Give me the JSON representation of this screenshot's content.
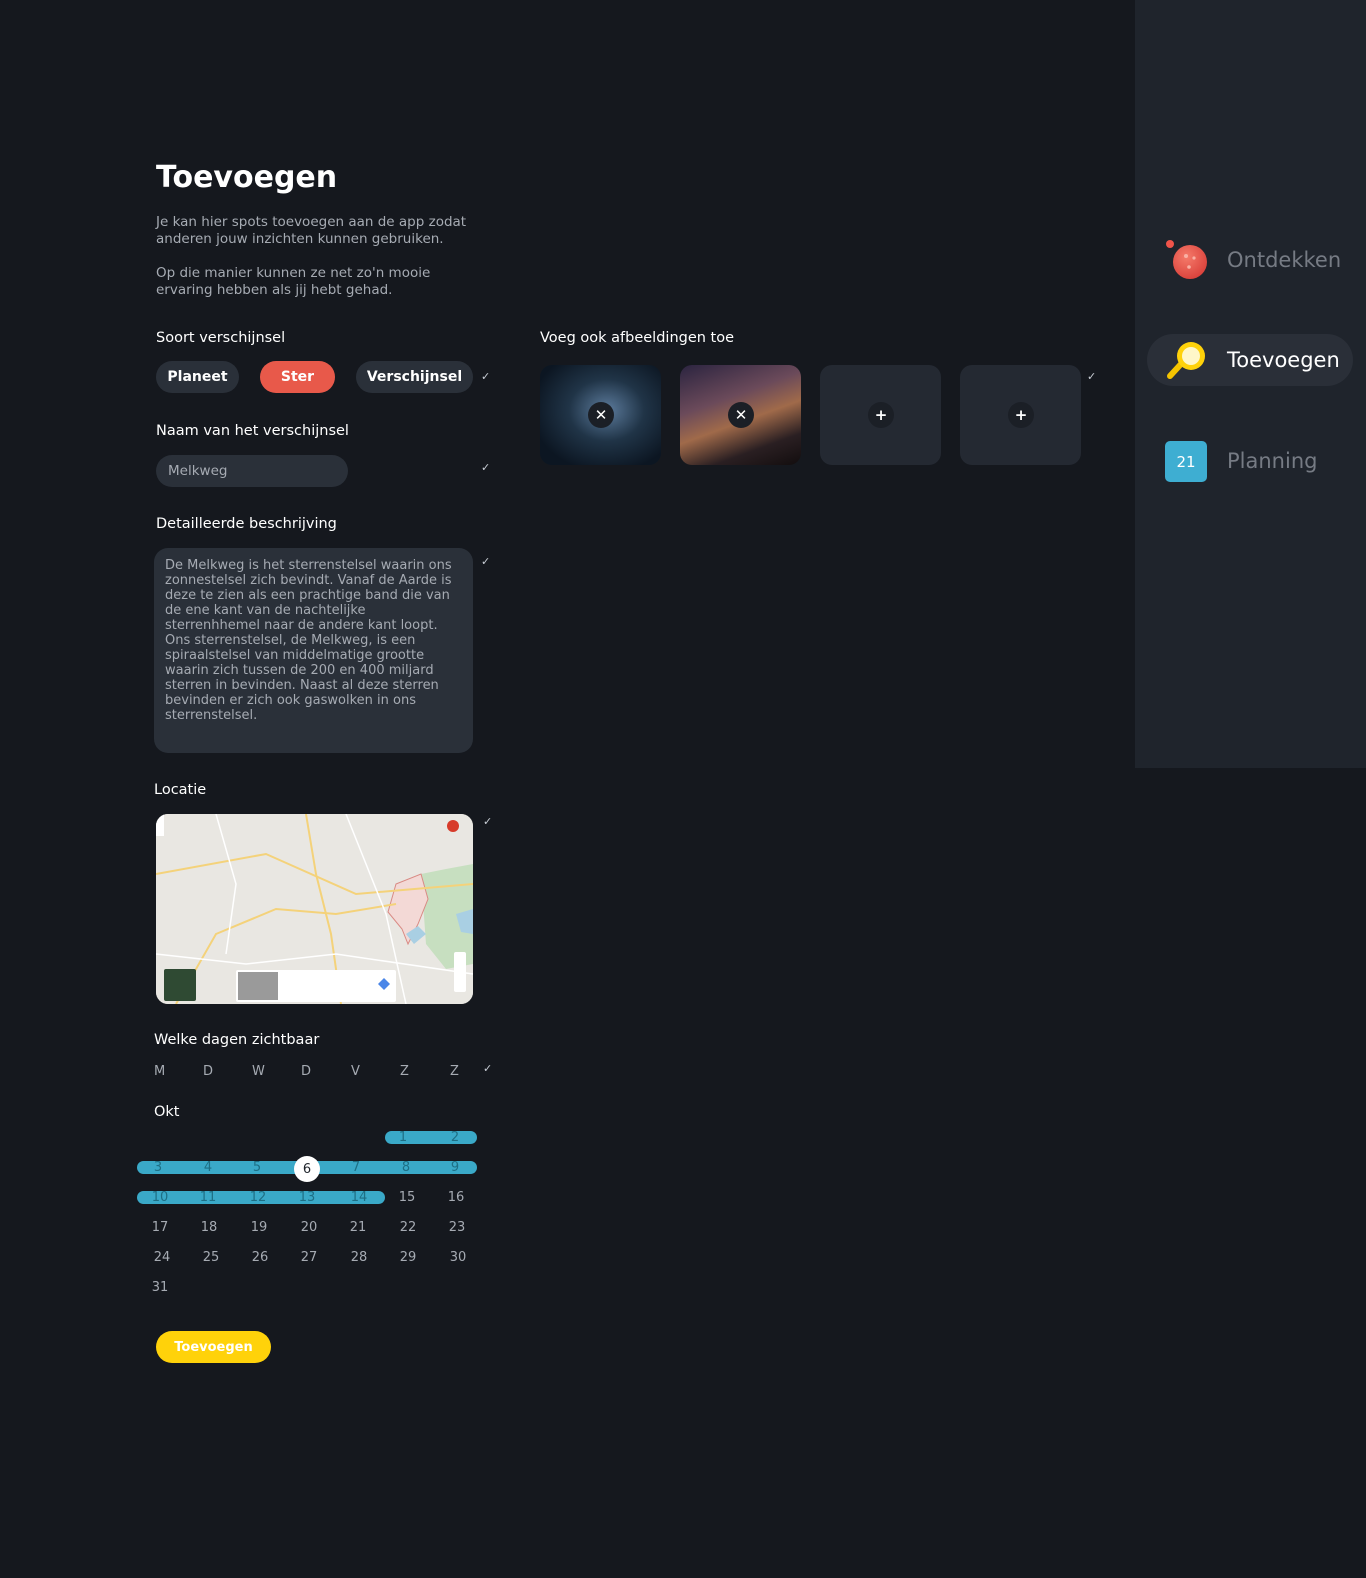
{
  "sidebar": {
    "items": [
      {
        "label": "Ontdekken",
        "icon": "planet-icon"
      },
      {
        "label": "Toevoegen",
        "icon": "magnifier-icon",
        "active": true
      },
      {
        "label": "Planning",
        "icon": "calendar-icon",
        "badge": "21"
      }
    ]
  },
  "page": {
    "title": "Toevoegen",
    "intro_1": "Je kan hier spots toevoegen aan de app zodat anderen jouw inzichten kunnen gebruiken.",
    "intro_2": "Op die manier kunnen ze net zo'n mooie ervaring hebben als jij hebt gehad."
  },
  "type_section": {
    "label": "Soort verschijnsel",
    "options": [
      "Planeet",
      "Ster",
      "Verschijnsel"
    ],
    "selected": "Ster"
  },
  "name_section": {
    "label": "Naam van het verschijnsel",
    "value": "Melkweg"
  },
  "description_section": {
    "label": "Detailleerde beschrijving",
    "value": "De Melkweg is het sterrenstelsel waarin ons zonnestelsel zich bevindt. Vanaf de Aarde is deze te zien als een prachtige band die van de ene kant van de nachtelijke sterrenhhemel naar de andere kant loopt. Ons sterrenstelsel, de Melkweg, is een spiraalstelsel van middelmatige grootte waarin zich tussen de 200 en 400 miljard sterren in bevinden. Naast al deze sterren bevinden er zich ook gaswolken in ons sterrenstelsel."
  },
  "location_section": {
    "label": "Locatie"
  },
  "images_section": {
    "label": "Voeg ook afbeeldingen toe",
    "remove_symbol": "✕",
    "add_symbol": "+"
  },
  "days_section": {
    "label": "Welke dagen zichtbaar",
    "weekdays": [
      "M",
      "D",
      "W",
      "D",
      "V",
      "Z",
      "Z"
    ],
    "month": "Okt",
    "days": [
      "1",
      "2",
      "3",
      "4",
      "5",
      "6",
      "7",
      "8",
      "9",
      "10",
      "11",
      "12",
      "13",
      "14",
      "15",
      "16",
      "17",
      "18",
      "19",
      "20",
      "21",
      "22",
      "23",
      "24",
      "25",
      "26",
      "27",
      "28",
      "29",
      "30",
      "31"
    ],
    "today": "6",
    "selected_range": [
      "1",
      "14"
    ]
  },
  "submit_label": "Toevoegen",
  "colors": {
    "background": "#15181e",
    "sidebar": "#1f242c",
    "accent_red": "#e8594a",
    "accent_yellow": "#ffd20a",
    "accent_blue": "#3aa9c8"
  }
}
